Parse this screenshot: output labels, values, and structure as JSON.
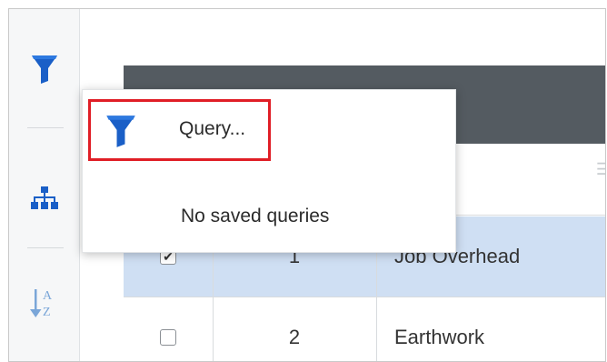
{
  "toolbar": {
    "items": [
      {
        "icon": "filter-icon"
      },
      {
        "icon": "hierarchy-icon"
      },
      {
        "icon": "sort-az-icon"
      }
    ],
    "sort_label_top": "A",
    "sort_label_bottom": "Z"
  },
  "menu": {
    "query_label": "Query...",
    "no_saved_label": "No saved queries"
  },
  "grid": {
    "rows": [
      {
        "checked": true,
        "number": "1",
        "name": "Job Overhead"
      },
      {
        "checked": false,
        "number": "2",
        "name": "Earthwork"
      }
    ]
  },
  "colors": {
    "accent_blue": "#1a5fc7",
    "highlight_red": "#e01e26",
    "header_dark": "#545b61",
    "selected_row": "#cfdff3"
  }
}
